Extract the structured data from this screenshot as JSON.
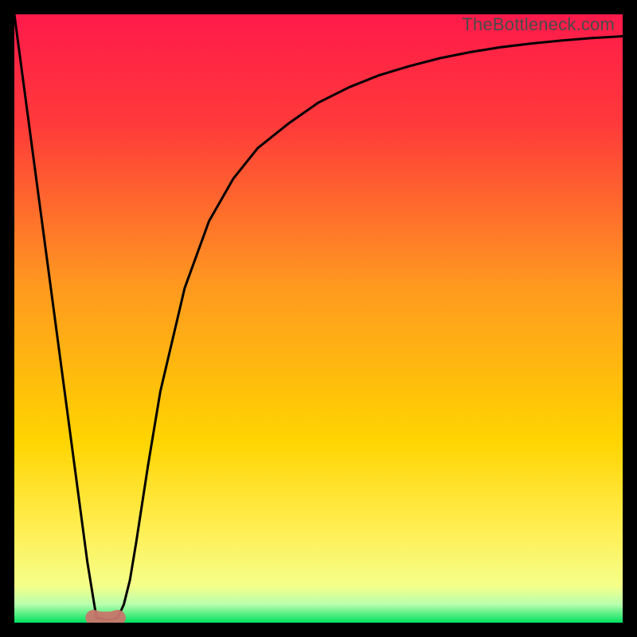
{
  "watermark": "TheBottleneck.com",
  "chart_data": {
    "type": "line",
    "title": "",
    "xlabel": "",
    "ylabel": "",
    "xlim": [
      0,
      100
    ],
    "ylim": [
      0,
      100
    ],
    "legend": false,
    "grid": false,
    "background_gradient": {
      "top": "#ff1a4b",
      "mid": "#ffd400",
      "bottom_thin_band": "#00e060"
    },
    "annotations": [
      {
        "text": "TheBottleneck.com",
        "position": "top-right",
        "color": "#4a4a4a"
      }
    ],
    "series": [
      {
        "name": "bottleneck-curve",
        "color": "#000000",
        "x": [
          0,
          2,
          4,
          6,
          8,
          10,
          12,
          13.5,
          15,
          16,
          17,
          18,
          19,
          20,
          22,
          24,
          28,
          32,
          36,
          40,
          45,
          50,
          55,
          60,
          65,
          70,
          75,
          80,
          85,
          90,
          95,
          100
        ],
        "y": [
          100,
          85,
          70,
          55,
          40,
          25,
          10,
          0.8,
          0.5,
          0.5,
          0.8,
          3,
          7,
          13,
          26,
          38,
          55,
          66,
          73,
          78,
          82,
          85.5,
          88,
          90,
          91.5,
          92.8,
          93.8,
          94.6,
          95.2,
          95.7,
          96.1,
          96.4
        ]
      },
      {
        "name": "dip-marker",
        "type": "scatter",
        "color": "#c8766b",
        "x": [
          13,
          14,
          15,
          16,
          17
        ],
        "y": [
          0.8,
          0.5,
          0.5,
          0.5,
          0.8
        ]
      }
    ]
  }
}
